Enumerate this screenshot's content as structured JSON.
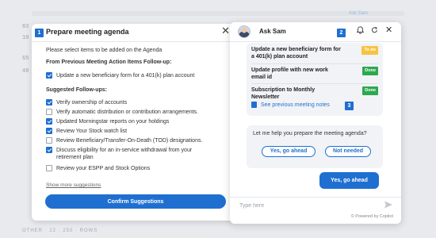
{
  "background": {
    "rows": [
      "83",
      "10",
      "65",
      "40"
    ],
    "top_right_text": "Ask Sam",
    "bottom_text": "OTHER  ·  22  ·  250  ·  ROWS"
  },
  "agenda_panel": {
    "badge": "1",
    "title": "Prepare meeting agenda",
    "instruction": "Please select items to be added on the Agenda",
    "section_previous": "From Previous Meeting Action Items Follow-up:",
    "previous_items": [
      {
        "label": "Update a new beneficiary form for a 401(k) plan account",
        "checked": true
      }
    ],
    "section_suggested": "Suggested Follow-ups:",
    "suggested_items": [
      {
        "label": "Verify ownership of accounts",
        "checked": true
      },
      {
        "label": "Verify automatic distribution or contribution arrangements.",
        "checked": false
      },
      {
        "label": "Updated Morningstar reports on your holdings",
        "checked": true
      },
      {
        "label": "Review Your Stock watch list",
        "checked": true
      },
      {
        "label": "Review Beneficiary/Transfer-On-Death (TOD) designations.",
        "checked": false
      },
      {
        "label": "Discuss eligibility for an in-service withdrawal from your retirement plan",
        "checked": true
      },
      {
        "label": "Review your ESPP and Stock Options",
        "checked": false
      }
    ],
    "show_more": "Show more suggestions",
    "confirm_label": "Confirm Suggestions"
  },
  "chat_panel": {
    "title": "Ask Sam",
    "badge_top": "2",
    "tasks": [
      {
        "text": "Update a new beneficiary form for a 401(k) plan account",
        "status": "To do",
        "status_color": "#f6c343"
      },
      {
        "text": "Update profile with new work email id",
        "status": "Done",
        "status_color": "#2ea84f"
      },
      {
        "text": "Subscription to Monthly Newsletter",
        "status": "Done",
        "status_color": "#2ea84f"
      }
    ],
    "see_previous": "See previous meeting notes",
    "badge_notes": "3",
    "help_text": "Let me help you prepare the meeting agenda?",
    "yes_label": "Yes, go ahead",
    "no_label": "Not needed",
    "user_reply": "Yes, go ahead",
    "input_placeholder": "Type here",
    "powered_by": "© Powered by Copilot"
  },
  "colors": {
    "accent": "#1f6fd1",
    "todo": "#f6c343",
    "done": "#2ea84f"
  }
}
